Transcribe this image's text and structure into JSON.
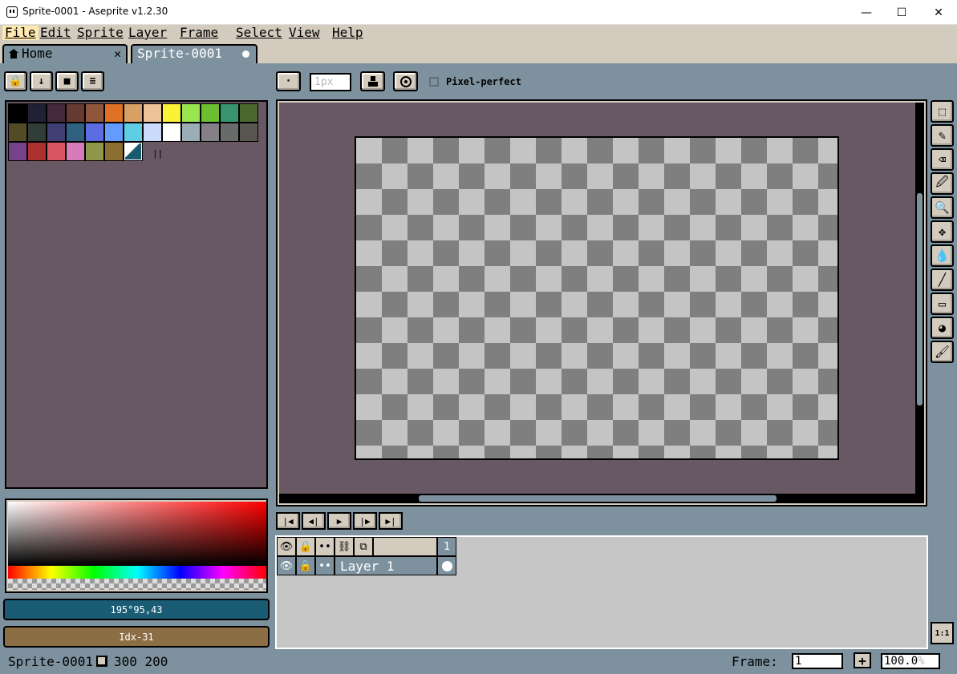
{
  "window": {
    "title": "Sprite-0001 - Aseprite v1.2.30",
    "minimize": "—",
    "maximize": "☐",
    "close": "✕"
  },
  "menu": [
    "File",
    "Edit",
    "Sprite",
    "Layer",
    "Frame",
    "Select",
    "View",
    "Help"
  ],
  "tabs": {
    "home": "Home",
    "home_close": "✕",
    "sprite": "Sprite-0001"
  },
  "palette_toolbar": [
    "🔒",
    "↓",
    "■",
    "≡"
  ],
  "palette": {
    "colors": [
      "#000000",
      "#222034",
      "#45283c",
      "#663931",
      "#8f563b",
      "#df7126",
      "#d9a066",
      "#eec39a",
      "#fbf236",
      "#99e550",
      "#6abe30",
      "#37946e",
      "#4b692f",
      "#524b24",
      "#323c39",
      "#3f3f74",
      "#306082",
      "#5b6ee1",
      "#639bff",
      "#5fcde4",
      "#cbdbfc",
      "#ffffff",
      "#9badb7",
      "#847e87",
      "#696a6a",
      "#595652",
      "#76428a",
      "#ac3232",
      "#d95763",
      "#d77bba",
      "#8f974a",
      "#8a6f30",
      "#1a5a6e"
    ],
    "resize_handle": "||"
  },
  "fg_color": {
    "label": "195°95,43",
    "hex": "#195c74"
  },
  "bg_color": {
    "label": "Idx-31",
    "hex": "#8c6e45"
  },
  "context_bar": {
    "brush_type": "·",
    "brush_size": "1px",
    "pixel_perfect": "Pixel-perfect"
  },
  "tools": [
    "⬚",
    "✎",
    "⌫",
    "🖉",
    "🔍",
    "✥",
    "💧",
    "╱",
    "▭",
    "◕",
    "🖌"
  ],
  "playback": [
    "|◀",
    "◀|",
    "▶",
    "|▶",
    "▶|"
  ],
  "timeline": {
    "header_icons": [
      "👁",
      "🔒",
      "••",
      "⛓",
      "⧉"
    ],
    "frame_number": "1",
    "layer_name": "Layer 1"
  },
  "zoom_one_to_one": "1:1",
  "status": {
    "sprite_name": "Sprite-0001",
    "size": "300 200",
    "frame_label": "Frame:",
    "frame_value": "1",
    "add_frame": "+",
    "zoom_value": "100.0",
    "zoom_suffix": "%"
  }
}
